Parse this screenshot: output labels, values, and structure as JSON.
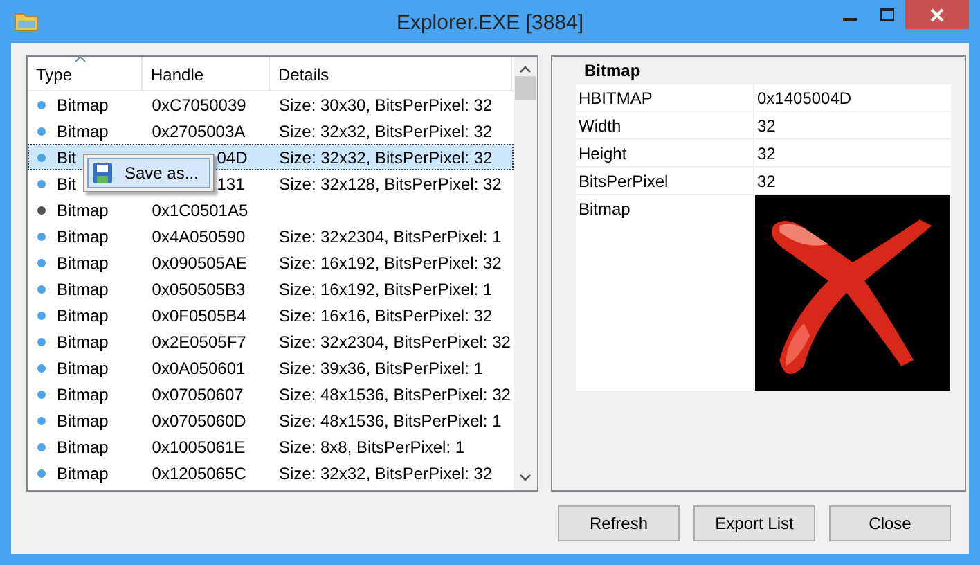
{
  "window": {
    "title": "Explorer.EXE [3884]"
  },
  "list": {
    "columns": [
      {
        "label": "Type",
        "sorted": true
      },
      {
        "label": "Handle",
        "sorted": false
      },
      {
        "label": "Details",
        "sorted": false
      }
    ],
    "rows": [
      {
        "type": "Bitmap",
        "handle": "0xC7050039",
        "details": "Size: 30x30, BitsPerPixel: 32",
        "color": "#4aa6e8",
        "selected": false
      },
      {
        "type": "Bitmap",
        "handle": "0x2705003A",
        "details": "Size: 32x32, BitsPerPixel: 32",
        "color": "#4aa6e8",
        "selected": false
      },
      {
        "type": "Bit",
        "handle": "04D",
        "details": "Size: 32x32, BitsPerPixel: 32",
        "color": "#4aa6e8",
        "selected": true,
        "covered": true
      },
      {
        "type": "Bit",
        "handle": "131",
        "details": "Size: 32x128, BitsPerPixel: 32",
        "color": "#4aa6e8",
        "selected": false,
        "covered": true
      },
      {
        "type": "Bitmap",
        "handle": "0x1C0501A5",
        "details": "",
        "color": "#555555",
        "selected": false
      },
      {
        "type": "Bitmap",
        "handle": "0x4A050590",
        "details": "Size: 32x2304, BitsPerPixel: 1",
        "color": "#4aa6e8",
        "selected": false
      },
      {
        "type": "Bitmap",
        "handle": "0x090505AE",
        "details": "Size: 16x192, BitsPerPixel: 32",
        "color": "#4aa6e8",
        "selected": false
      },
      {
        "type": "Bitmap",
        "handle": "0x050505B3",
        "details": "Size: 16x192, BitsPerPixel: 1",
        "color": "#4aa6e8",
        "selected": false
      },
      {
        "type": "Bitmap",
        "handle": "0x0F0505B4",
        "details": "Size: 16x16, BitsPerPixel: 32",
        "color": "#4aa6e8",
        "selected": false
      },
      {
        "type": "Bitmap",
        "handle": "0x2E0505F7",
        "details": "Size: 32x2304, BitsPerPixel: 32",
        "color": "#4aa6e8",
        "selected": false
      },
      {
        "type": "Bitmap",
        "handle": "0x0A050601",
        "details": "Size: 39x36, BitsPerPixel: 1",
        "color": "#4aa6e8",
        "selected": false
      },
      {
        "type": "Bitmap",
        "handle": "0x07050607",
        "details": "Size: 48x1536, BitsPerPixel: 32",
        "color": "#4aa6e8",
        "selected": false
      },
      {
        "type": "Bitmap",
        "handle": "0x0705060D",
        "details": "Size: 48x1536, BitsPerPixel: 1",
        "color": "#4aa6e8",
        "selected": false
      },
      {
        "type": "Bitmap",
        "handle": "0x1005061E",
        "details": "Size: 8x8, BitsPerPixel: 1",
        "color": "#4aa6e8",
        "selected": false
      },
      {
        "type": "Bitmap",
        "handle": "0x1205065C",
        "details": "Size: 32x32, BitsPerPixel: 32",
        "color": "#4aa6e8",
        "selected": false
      }
    ]
  },
  "context_menu": {
    "items": [
      "Save as..."
    ]
  },
  "properties": {
    "heading": "Bitmap",
    "rows": [
      {
        "kind": "text",
        "label": "HBITMAP",
        "value": "0x1405004D"
      },
      {
        "kind": "text",
        "label": "Width",
        "value": "32"
      },
      {
        "kind": "text",
        "label": "Height",
        "value": "32"
      },
      {
        "kind": "text",
        "label": "BitsPerPixel",
        "value": "32"
      },
      {
        "kind": "picture",
        "label": "Bitmap"
      }
    ]
  },
  "buttons": [
    "Refresh",
    "Export List",
    "Close"
  ]
}
